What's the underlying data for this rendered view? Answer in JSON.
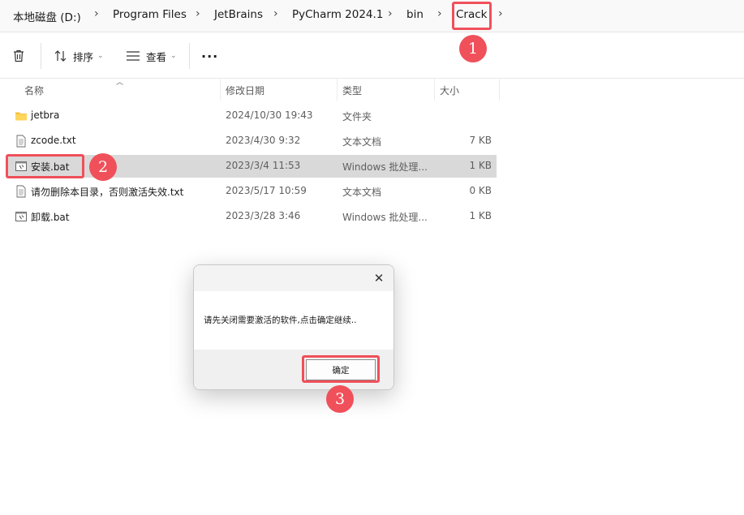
{
  "breadcrumb": {
    "items": [
      "本地磁盘 (D:)",
      "Program Files",
      "JetBrains",
      "PyCharm 2024.1",
      "bin",
      "Crack"
    ],
    "separator": ">"
  },
  "toolbar": {
    "sort_label": "排序",
    "view_label": "查看",
    "more_label": "···"
  },
  "columns": {
    "name": "名称",
    "modified": "修改日期",
    "type": "类型",
    "size": "大小"
  },
  "files": [
    {
      "name": "jetbra",
      "modified": "2024/10/30 19:43",
      "type": "文件夹",
      "size": "",
      "icon": "folder-icon"
    },
    {
      "name": "zcode.txt",
      "modified": "2023/4/30 9:32",
      "type": "文本文档",
      "size": "7 KB",
      "icon": "text-file-icon"
    },
    {
      "name": "安装.bat",
      "modified": "2023/3/4 11:53",
      "type": "Windows 批处理...",
      "size": "1 KB",
      "icon": "batch-file-icon",
      "selected": true
    },
    {
      "name": "请勿删除本目录，否则激活失效.txt",
      "modified": "2023/5/17 10:59",
      "type": "文本文档",
      "size": "0 KB",
      "icon": "text-file-icon"
    },
    {
      "name": "卸载.bat",
      "modified": "2023/3/28 3:46",
      "type": "Windows 批处理...",
      "size": "1 KB",
      "icon": "batch-file-icon"
    }
  ],
  "dialog": {
    "message": "请先关闭需要激活的软件,点击确定继续..",
    "ok_label": "确定",
    "close_glyph": "✕"
  },
  "annotations": {
    "step1": "1",
    "step2": "2",
    "step3": "3",
    "color": "#f0505a"
  },
  "colors": {
    "selected_row": "#d9d9d9",
    "folder": "#f5c341"
  }
}
